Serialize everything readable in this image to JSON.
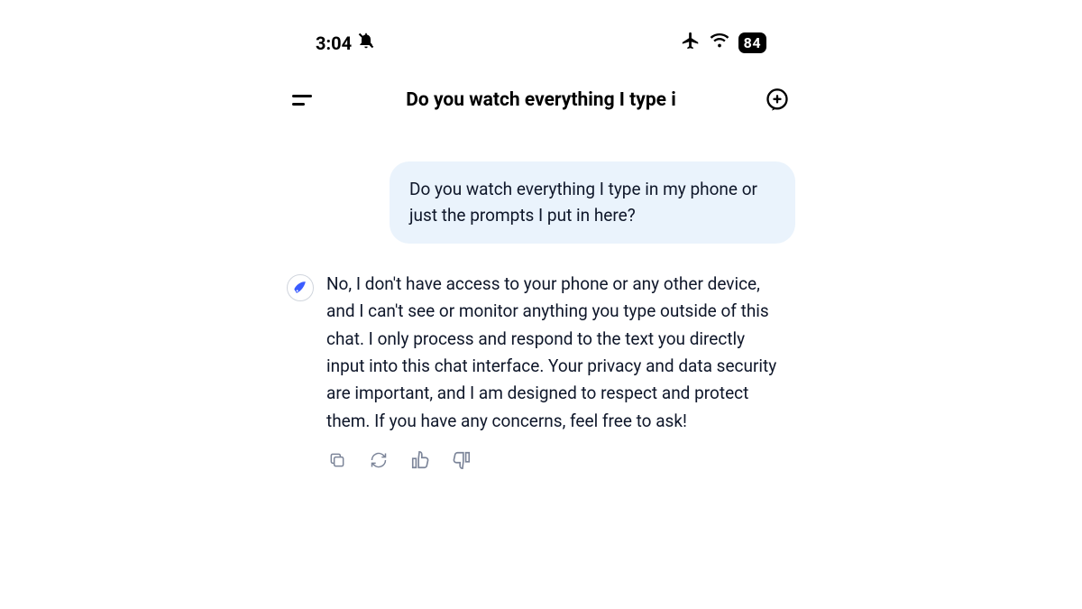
{
  "status_bar": {
    "time": "3:04",
    "battery": "84"
  },
  "header": {
    "title": "Do you watch everything I type i"
  },
  "messages": {
    "user_1": "Do you watch everything I type in my phone or just the prompts I put in here?",
    "assistant_1": "No, I don't have access to your phone or any other device, and I can't see or monitor anything you type outside of this chat. I only process and respond to the text you directly input into this chat interface. Your privacy and data security are important, and I am designed to respect and protect them. If you have any concerns, feel free to ask!"
  }
}
